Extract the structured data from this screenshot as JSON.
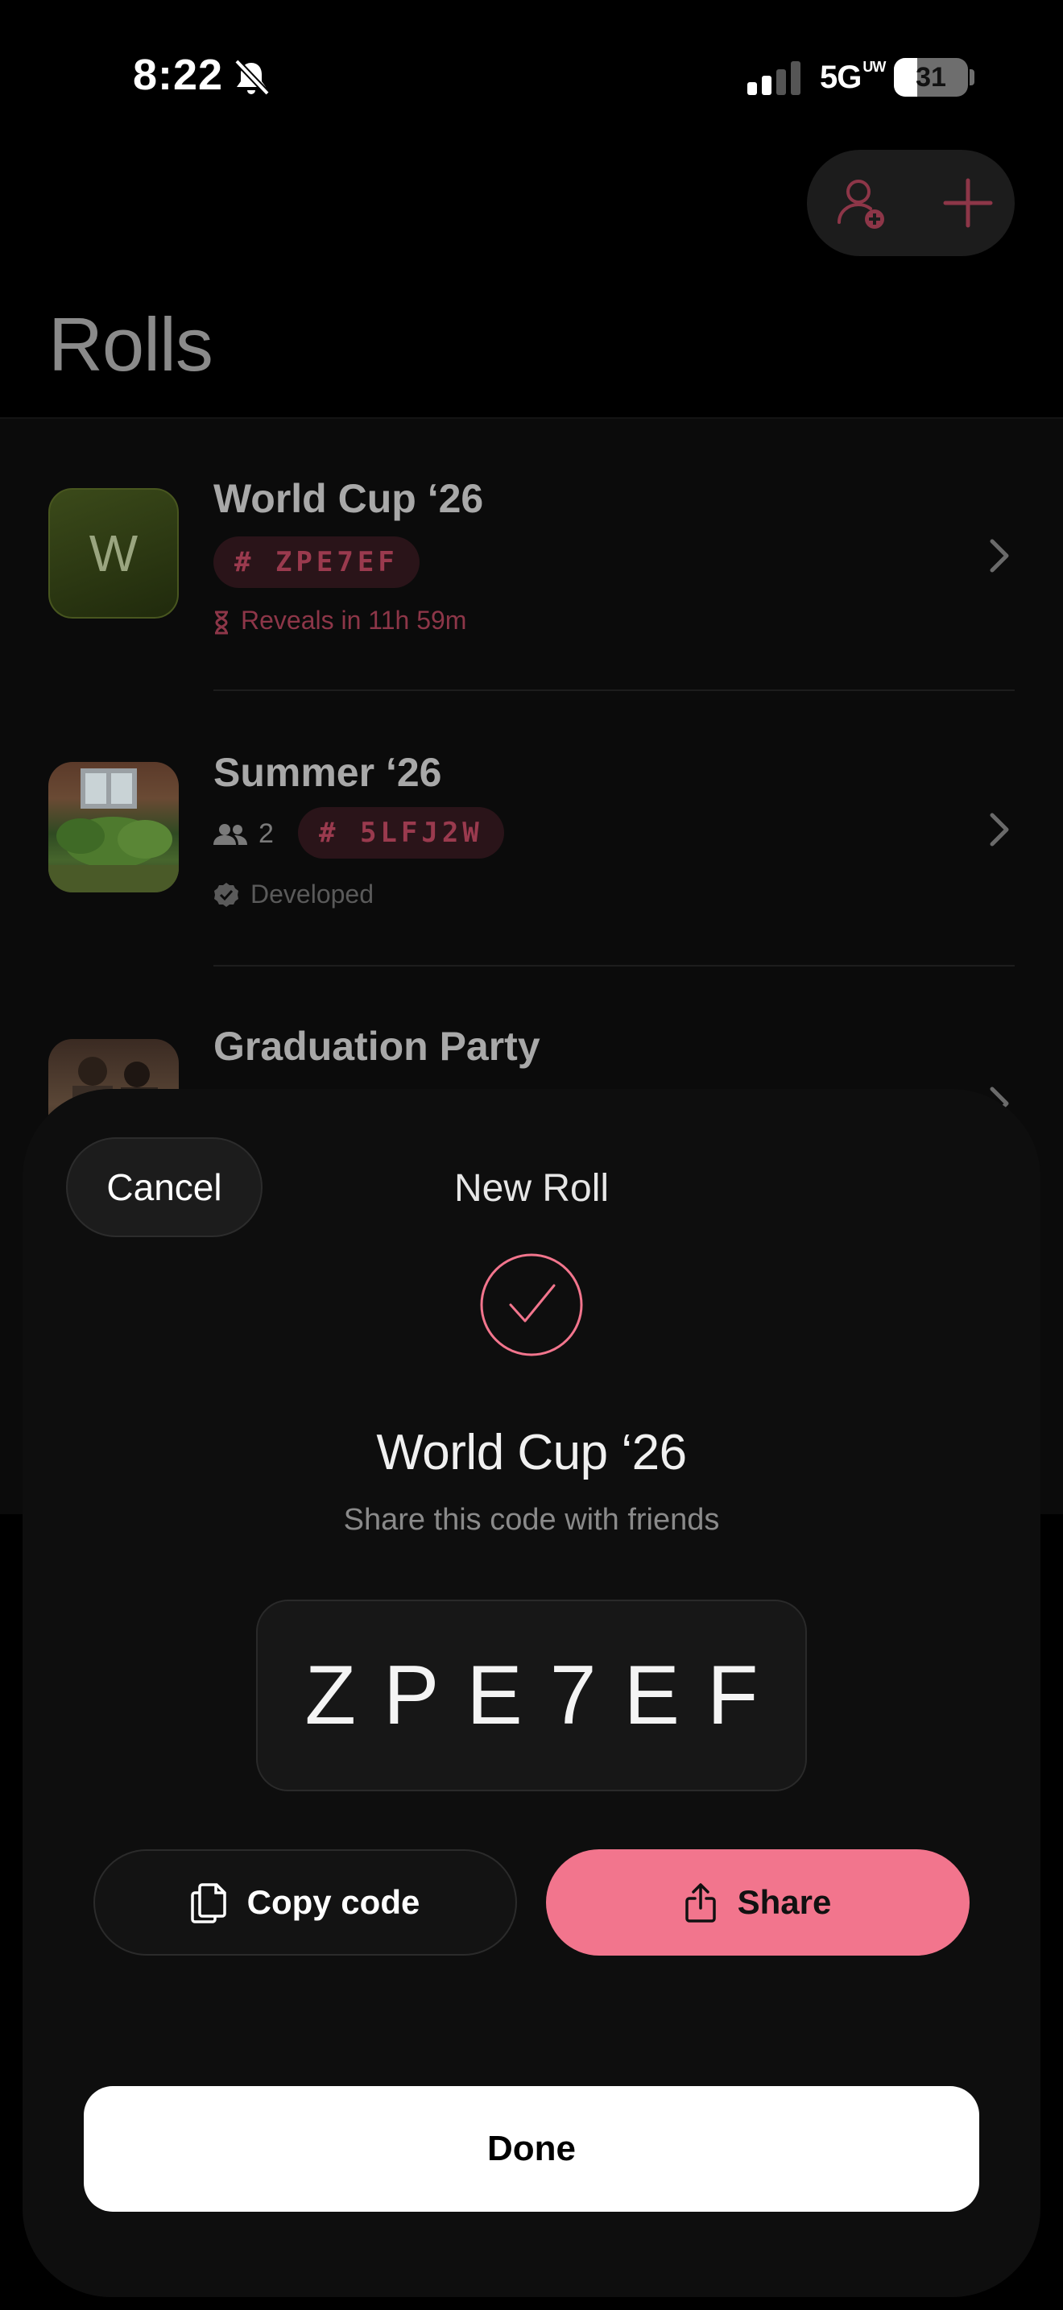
{
  "status_bar": {
    "time": "8:22",
    "network": "5G",
    "network_suffix": "UW",
    "battery": "31",
    "battery_level_percent": 31
  },
  "header": {
    "title": "Rolls",
    "icons": [
      "add-person-icon",
      "plus-icon"
    ]
  },
  "rolls": [
    {
      "title": "World Cup ‘26",
      "thumb_letter": "W",
      "code": "# ZPE7EF",
      "status": "Reveals in 11h 59m"
    },
    {
      "title": "Summer ‘26",
      "members": "2",
      "code": "# 5LFJ2W",
      "status": "Developed"
    },
    {
      "title": "Graduation Party"
    }
  ],
  "sheet": {
    "cancel_label": "Cancel",
    "title": "New Roll",
    "roll_name": "World Cup ‘26",
    "hint": "Share this code with friends",
    "code": "ZPE7EF",
    "copy_label": "Copy code",
    "share_label": "Share",
    "done_label": "Done"
  },
  "colors": {
    "accent": "#f2758d",
    "chip_text": "#9a3a4e",
    "background": "#000000"
  }
}
